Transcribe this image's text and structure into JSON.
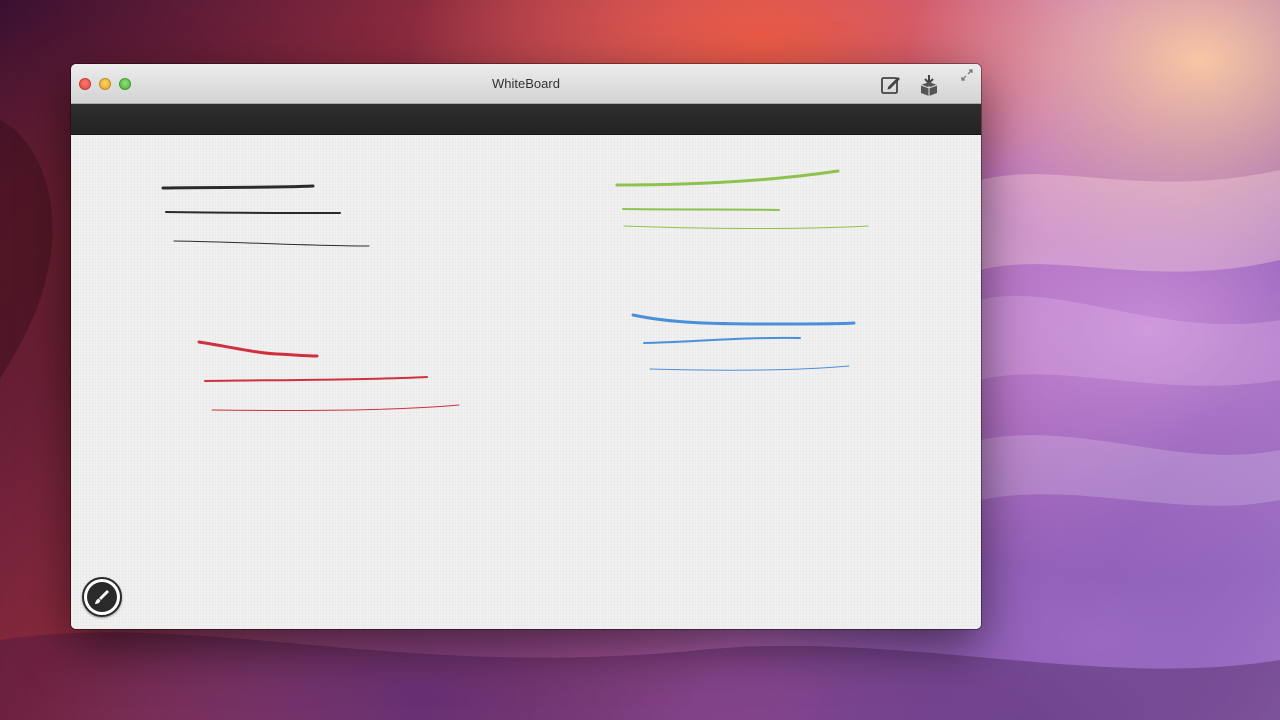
{
  "window": {
    "title": "WhiteBoard"
  },
  "titlebar_buttons": {
    "close": "close-icon",
    "minimize": "minimize-icon",
    "zoom": "zoom-icon",
    "compose": "compose-icon",
    "export": "export-icon",
    "fullscreen": "fullscreen-icon"
  },
  "tools": {
    "brush": {
      "icon": "brush-icon",
      "selected": true
    },
    "eraser": {
      "icon": "eraser-icon",
      "selected": false
    }
  },
  "brush_sizes": [
    {
      "name": "small",
      "selected": true
    },
    {
      "name": "medium",
      "selected": false
    },
    {
      "name": "large",
      "selected": false
    }
  ],
  "colors": [
    {
      "name": "black",
      "hex": "#2b2b2b",
      "selected": false
    },
    {
      "name": "red",
      "hex": "#d0303d",
      "selected": false
    },
    {
      "name": "blue",
      "hex": "#4a90d9",
      "selected": true
    },
    {
      "name": "green",
      "hex": "#8dc24f",
      "selected": false
    }
  ],
  "actions": {
    "restore": "restore-window-icon",
    "close": "close-circle-icon"
  },
  "strokes": [
    {
      "color": "#2b2b2b",
      "width": 3
    },
    {
      "color": "#2b2b2b",
      "width": 2
    },
    {
      "color": "#2b2b2b",
      "width": 1
    },
    {
      "color": "#8dc24f",
      "width": 3
    },
    {
      "color": "#8dc24f",
      "width": 2
    },
    {
      "color": "#8dc24f",
      "width": 1
    },
    {
      "color": "#d0303d",
      "width": 3
    },
    {
      "color": "#d0303d",
      "width": 2
    },
    {
      "color": "#d0303d",
      "width": 1
    },
    {
      "color": "#4a90d9",
      "width": 3
    },
    {
      "color": "#4a90d9",
      "width": 2
    },
    {
      "color": "#4a90d9",
      "width": 1
    }
  ]
}
